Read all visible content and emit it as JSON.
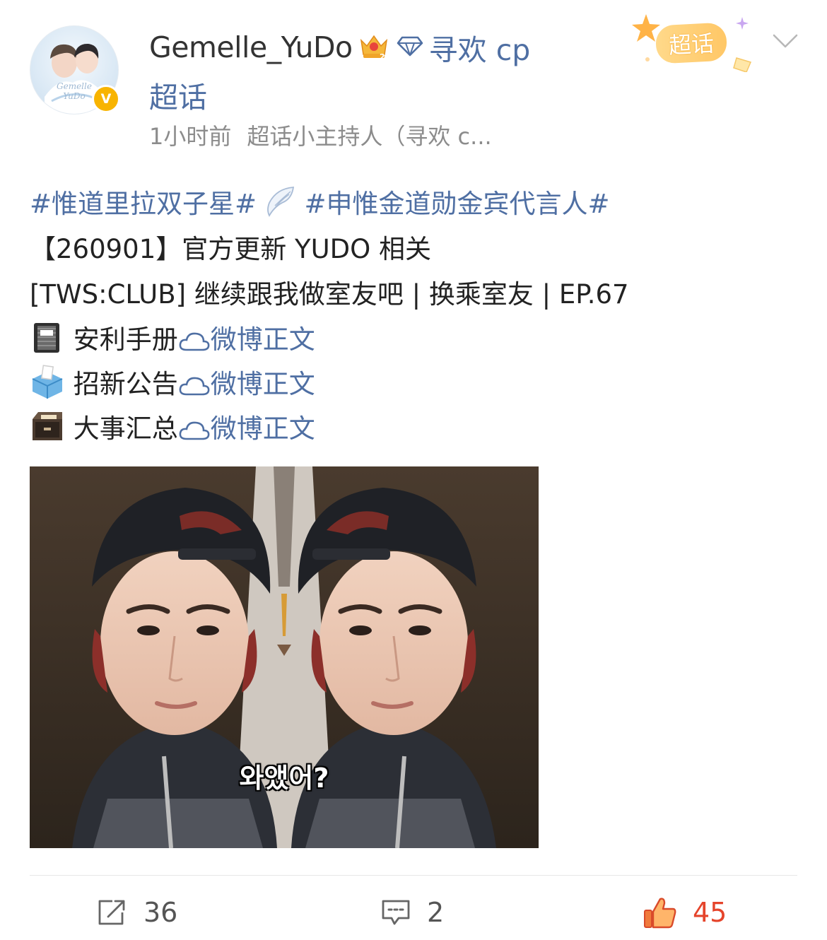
{
  "post": {
    "author": {
      "name": "Gemelle_YuDo",
      "avatar_caption": "Gemelle YuDo",
      "verified_symbol": "V"
    },
    "supertopic": {
      "name_line1": "寻欢 cp",
      "name_line2": "超话",
      "badge_label": "超话"
    },
    "meta": {
      "time": "1小时前",
      "role": "超话小主持人（寻欢 c..."
    },
    "content": {
      "hashtag1": "#惟道里拉双子星#",
      "hashtag2": "#申惟金道勋金宾代言人#",
      "line2": "【260901】官方更新 YUDO 相关",
      "line3": "[TWS:CLUB] 继续跟我做室友吧 | 换乘室友 | EP.67",
      "links": [
        {
          "label": "安利手册",
          "link_text": "微博正文",
          "icon": "notebook-emoji"
        },
        {
          "label": "招新公告",
          "link_text": "微博正文",
          "icon": "ballot-box-emoji"
        },
        {
          "label": "大事汇总",
          "link_text": "微博正文",
          "icon": "file-cabinet-emoji"
        }
      ]
    },
    "image": {
      "subtitle": "와앴어?"
    },
    "actions": {
      "share_count": "36",
      "comment_count": "2",
      "like_count": "45"
    }
  },
  "colors": {
    "link_blue": "#4f6fa3",
    "like_red": "#e5442b",
    "badge_gold": "#f8b400"
  }
}
